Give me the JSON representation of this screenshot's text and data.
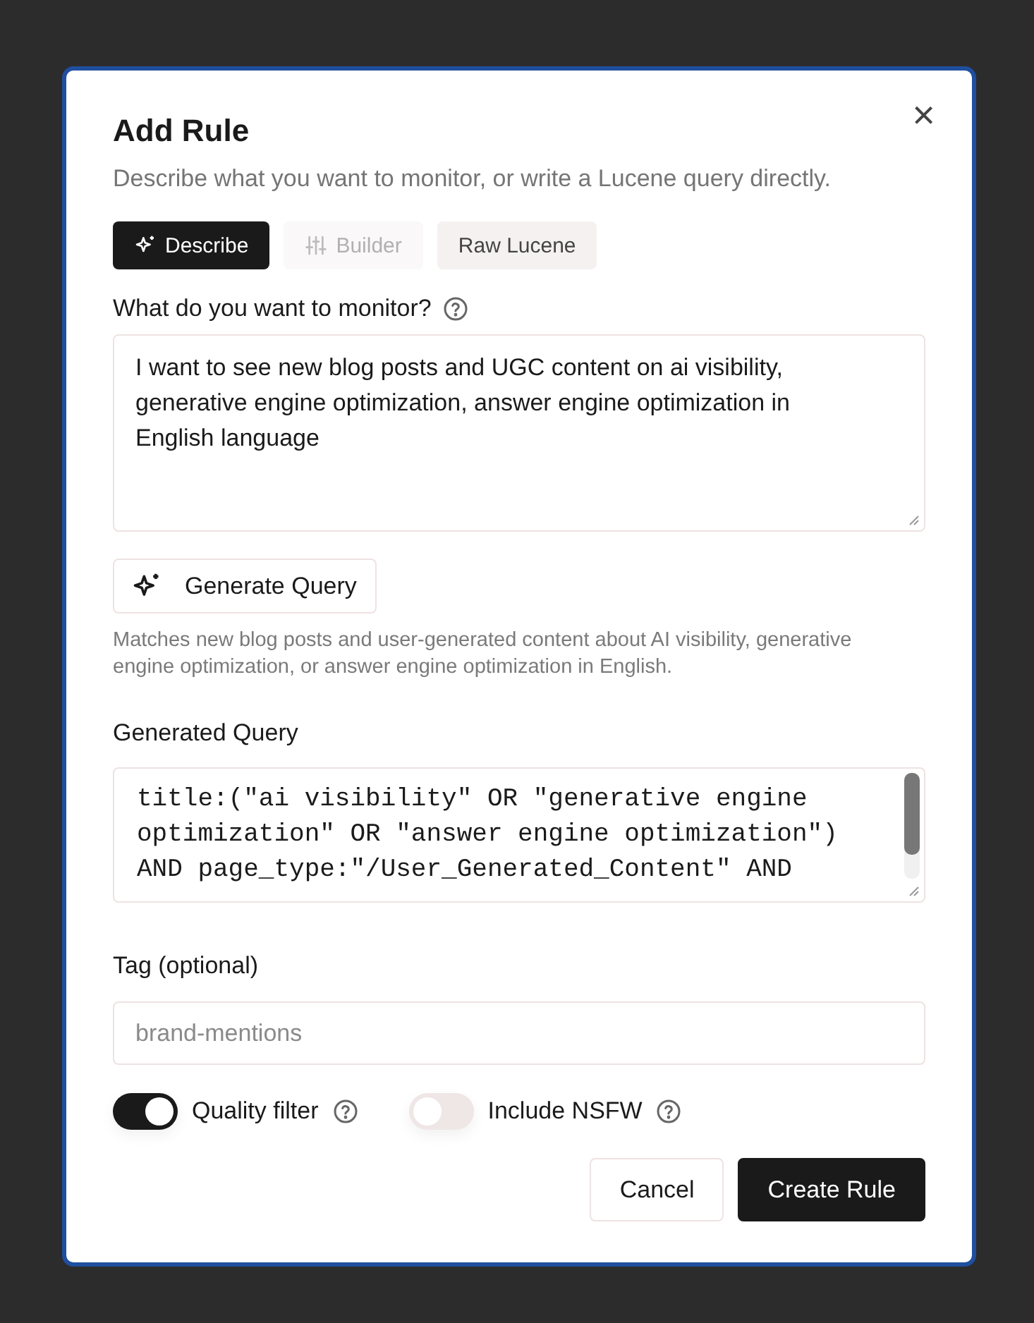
{
  "dialog": {
    "title": "Add Rule",
    "subtitle": "Describe what you want to monitor, or write a Lucene query directly.",
    "close": "×"
  },
  "tabs": [
    {
      "label": "Describe",
      "selected": true,
      "disabled": false,
      "kind": "sparkle"
    },
    {
      "label": "Builder",
      "selected": false,
      "disabled": true,
      "kind": "sliders"
    },
    {
      "label": "Raw Lucene",
      "selected": false,
      "disabled": false,
      "kind": "none"
    }
  ],
  "monitor": {
    "label": "What do you want to monitor?",
    "value": "I want to see new blog posts and UGC content on ai visibility, generative engine optimization, answer engine optimization in English language"
  },
  "generate_button": "Generate Query",
  "summary": "Matches new blog posts and user-generated content about AI visibility, generative engine optimization, or answer engine optimization in English.",
  "generated_query": {
    "label": "Generated Query",
    "value": "title:(\"ai visibility\" OR \"generative engine optimization\" OR \"answer engine optimization\") AND page_type:\"/User_Generated_Content\" AND"
  },
  "tag": {
    "label": "Tag (optional)",
    "placeholder": "brand-mentions"
  },
  "toggles": [
    {
      "label": "Quality filter",
      "on": true
    },
    {
      "label": "Include NSFW",
      "on": false
    }
  ],
  "buttons": [
    {
      "label": "Cancel",
      "kind": "secondary"
    },
    {
      "label": "Create Rule",
      "kind": "primary"
    }
  ]
}
